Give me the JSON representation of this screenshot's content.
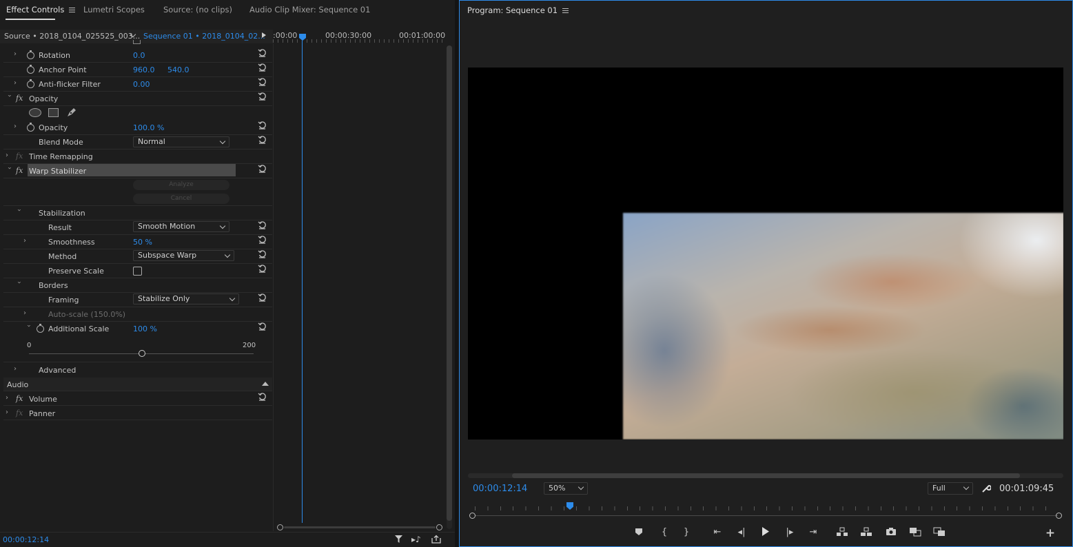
{
  "left_tabs": [
    "Effect Controls",
    "Lumetri Scopes",
    "Source: (no clips)",
    "Audio Clip Mixer: Sequence 01"
  ],
  "source_header": {
    "source": "Source • 2018_0104_025525_003...",
    "sequence": "Sequence 01 • 2018_0104_02...",
    "ruler": [
      ":00:00",
      "00:00:30:00",
      "00:01:00:00"
    ]
  },
  "effects": {
    "rotation": {
      "label": "Rotation",
      "value": "0.0"
    },
    "anchor": {
      "label": "Anchor Point",
      "x": "960.0",
      "y": "540.0"
    },
    "antiflicker": {
      "label": "Anti-flicker Filter",
      "value": "0.00"
    },
    "opacity_section": "Opacity",
    "opacity": {
      "label": "Opacity",
      "value": "100.0 %"
    },
    "blend": {
      "label": "Blend Mode",
      "value": "Normal"
    },
    "time_remap": "Time Remapping",
    "warp": "Warp Stabilizer",
    "analyze": "Analyze",
    "cancel": "Cancel",
    "stabilization": "Stabilization",
    "result": {
      "label": "Result",
      "value": "Smooth Motion"
    },
    "smoothness": {
      "label": "Smoothness",
      "value": "50 %"
    },
    "method": {
      "label": "Method",
      "value": "Subspace Warp"
    },
    "preserve_scale": {
      "label": "Preserve Scale",
      "checked": false
    },
    "borders": "Borders",
    "framing": {
      "label": "Framing",
      "value": "Stabilize Only"
    },
    "autoscale": "Auto-scale (150.0%)",
    "additional_scale": {
      "label": "Additional Scale",
      "value": "100 %"
    },
    "slider": {
      "min": "0",
      "max": "200",
      "value": 100
    },
    "advanced": "Advanced",
    "audio": "Audio",
    "volume": "Volume",
    "panner": "Panner"
  },
  "left_timecode": "00:00:12:14",
  "program": {
    "title": "Program: Sequence 01",
    "timecode": "00:00:12:14",
    "zoom": "50%",
    "quality": "Full",
    "duration": "00:01:09:45",
    "playhead_fraction": 0.168
  },
  "colors": {
    "accent": "#2d8ceb",
    "panel": "#1d1d1d",
    "video_bg": "#000000"
  }
}
